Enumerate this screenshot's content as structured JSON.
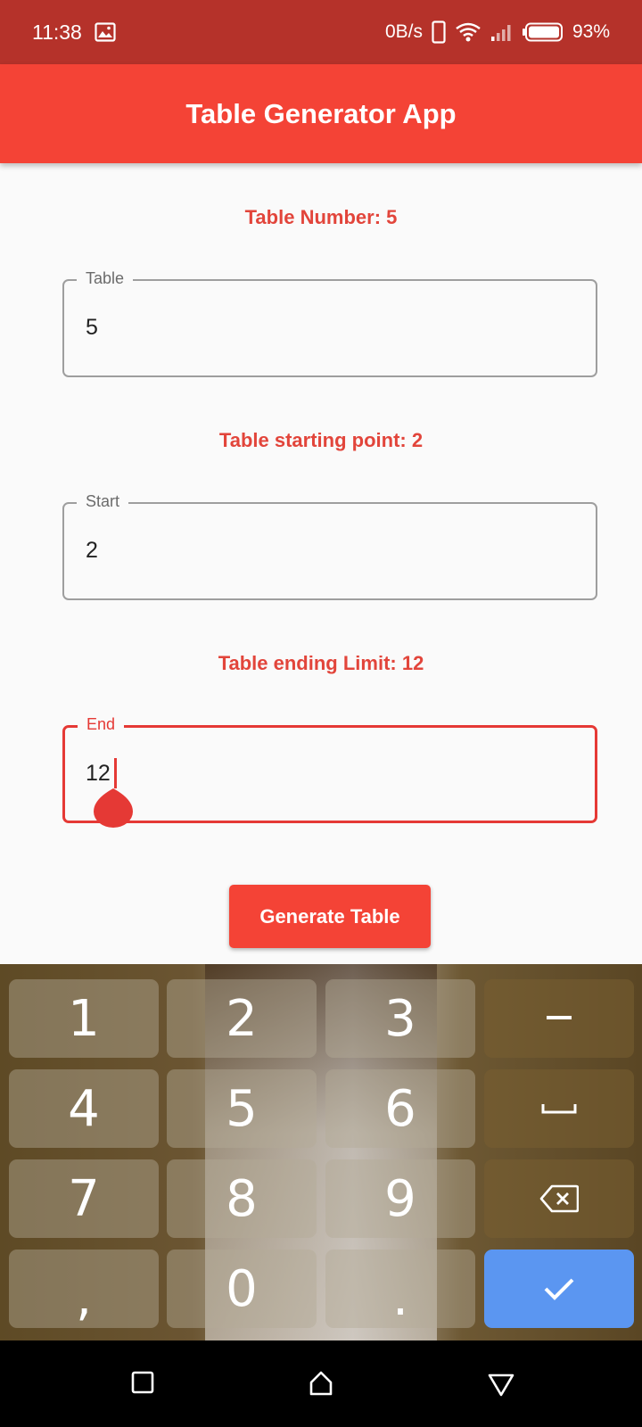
{
  "status_bar": {
    "time": "11:38",
    "net_speed": "0B/s",
    "battery": "93%",
    "icons": [
      "gallery-icon",
      "phone-icon",
      "wifi-icon",
      "signal-icon",
      "battery-icon"
    ]
  },
  "app_bar": {
    "title": "Table Generator App"
  },
  "form": {
    "table_label": "Table Number:  5",
    "table_field": {
      "legend": "Table",
      "value": "5"
    },
    "start_label": "Table starting point:  2",
    "start_field": {
      "legend": "Start",
      "value": "2"
    },
    "end_label": "Table ending Limit:  12",
    "end_field": {
      "legend": "End",
      "value": "12"
    },
    "generate_button": "Generate Table"
  },
  "keyboard": {
    "keys": [
      "1",
      "2",
      "3",
      "–",
      "4",
      "5",
      "6",
      "␣",
      "7",
      "8",
      "9",
      "backspace",
      ",",
      "0",
      ".",
      "done"
    ],
    "row1": {
      "k1": "1",
      "k2": "2",
      "k3": "3",
      "k4": "–"
    },
    "row2": {
      "k1": "4",
      "k2": "5",
      "k3": "6"
    },
    "row3": {
      "k1": "7",
      "k2": "8",
      "k3": "9"
    },
    "row4": {
      "k1": ",",
      "k2": "0",
      "k3": "."
    },
    "accent_color": "#5b96f1"
  },
  "colors": {
    "primary": "#f44336",
    "status_bar": "#b5322a",
    "label_text": "#e2453b"
  }
}
